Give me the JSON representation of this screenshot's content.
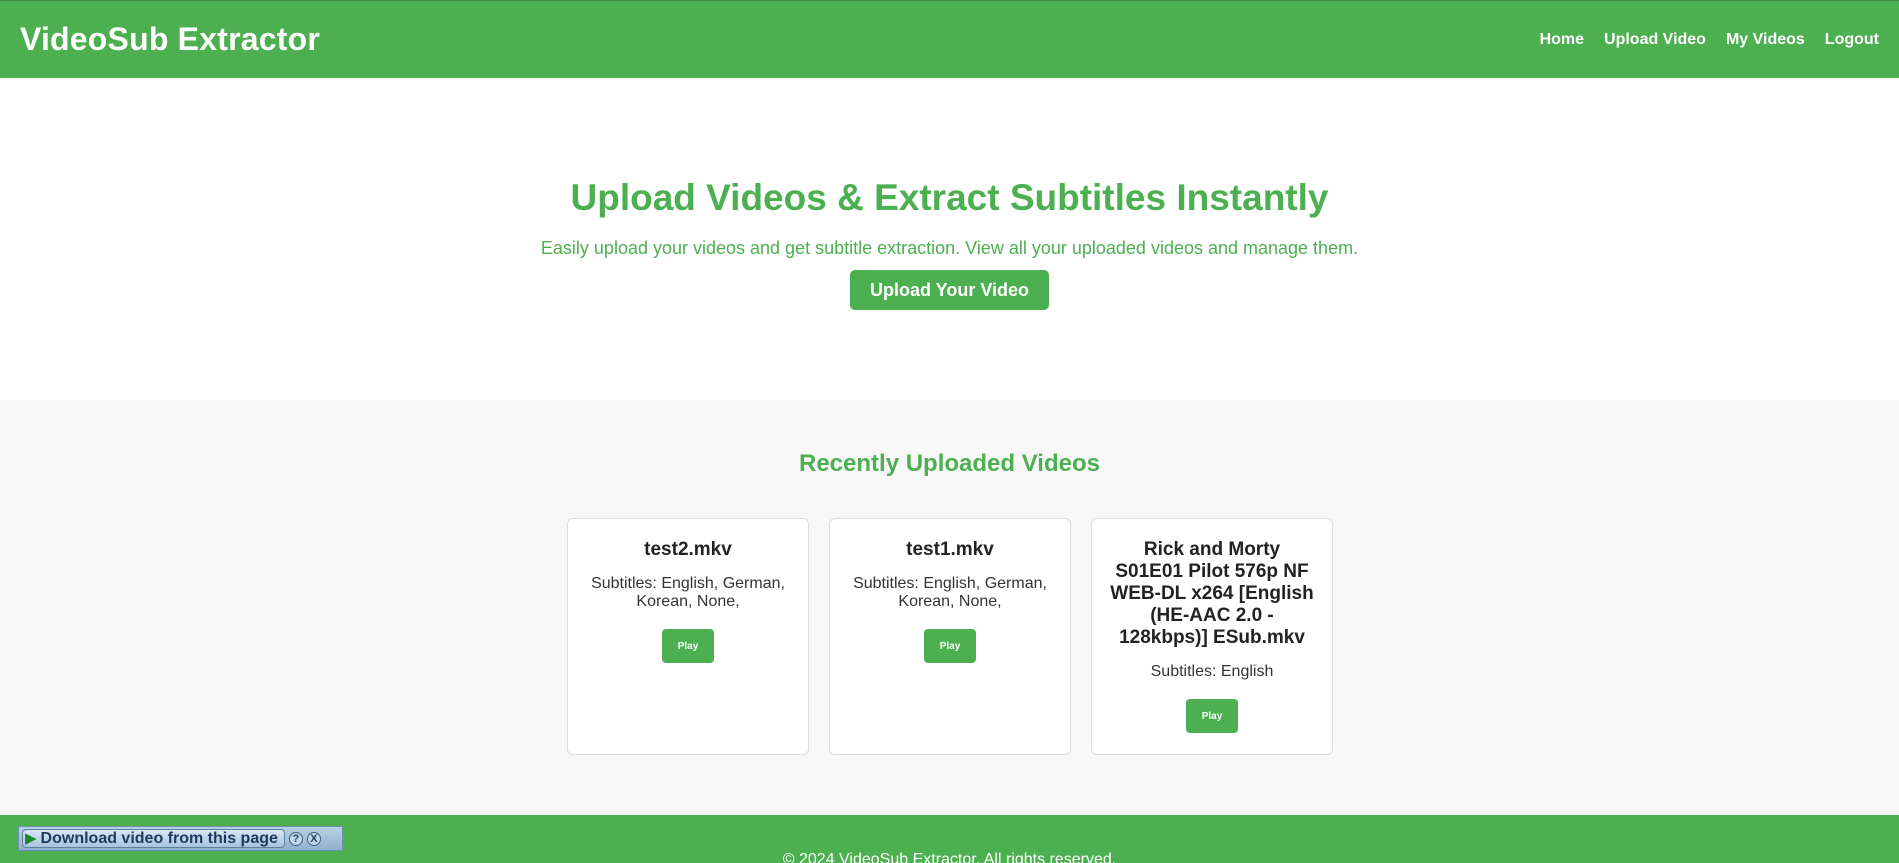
{
  "header": {
    "brand": "VideoSub Extractor",
    "nav": [
      "Home",
      "Upload Video",
      "My Videos",
      "Logout"
    ]
  },
  "hero": {
    "title": "Upload Videos & Extract Subtitles Instantly",
    "subtitle": "Easily upload your videos and get subtitle extraction. View all your uploaded videos and manage them.",
    "button": "Upload Your Video"
  },
  "recent": {
    "title": "Recently Uploaded Videos",
    "videos": [
      {
        "title": "test2.mkv",
        "subtitles": "Subtitles: English, German, Korean, None,",
        "play": "Play"
      },
      {
        "title": "test1.mkv",
        "subtitles": "Subtitles: English, German, Korean, None,",
        "play": "Play"
      },
      {
        "title": "Rick and Morty S01E01 Pilot 576p NF WEB-DL x264 [English (HE-AAC 2.0 - 128kbps)] ESub.mkv",
        "subtitles": "Subtitles: English",
        "play": "Play"
      }
    ]
  },
  "footer": {
    "text": "© 2024 VideoSub Extractor. All rights reserved."
  },
  "download_bar": {
    "label": "Download video from this page",
    "help": "?",
    "close": "X"
  },
  "colors": {
    "brand_green": "#4caf50",
    "section_bg": "#f8f8f8"
  }
}
